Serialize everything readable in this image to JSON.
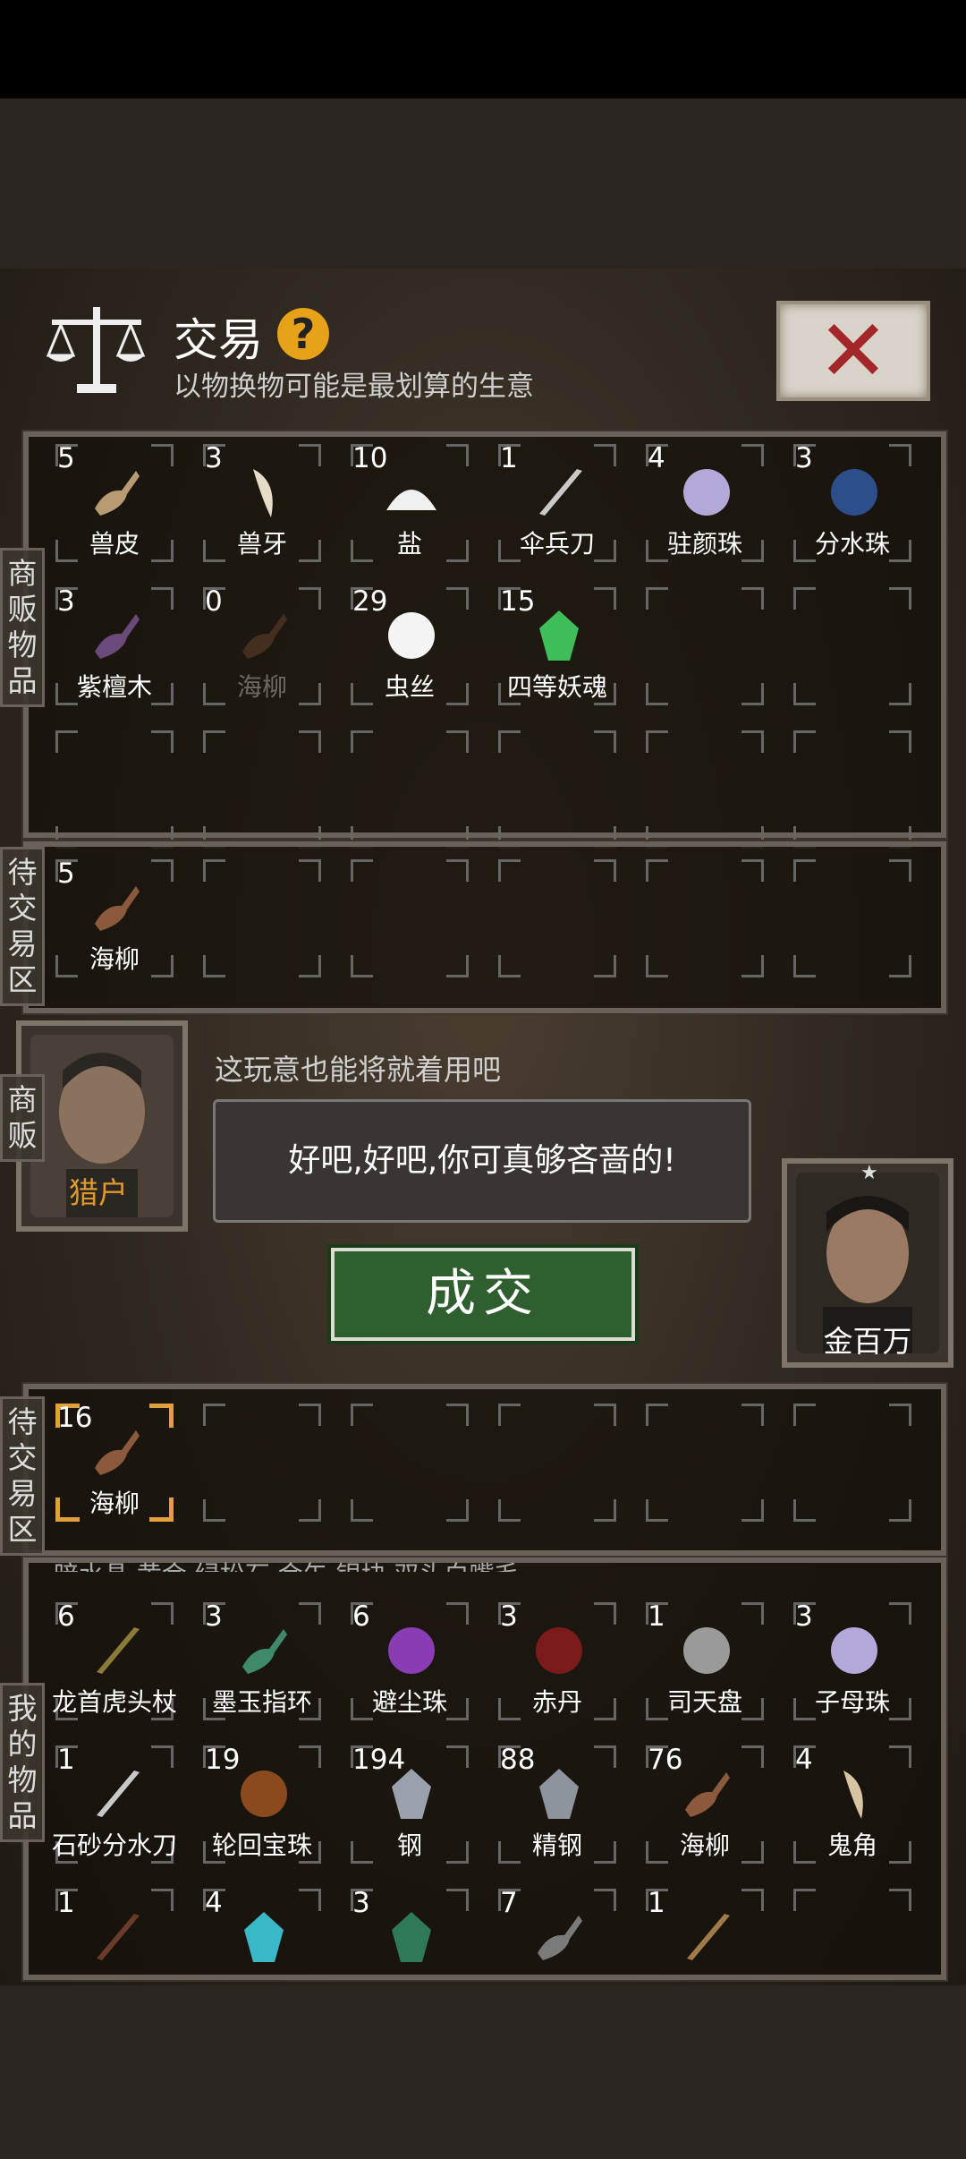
{
  "header": {
    "title": "交易",
    "help_icon": "?",
    "subtitle": "以物换物可能是最划算的生意",
    "close_icon": "close-x-icon"
  },
  "side_labels": {
    "merchant_goods": "商贩物品",
    "pending_top": "待交易区",
    "merchant": "商贩",
    "pending_bottom": "待交易区",
    "my_goods": "我的物品"
  },
  "merchant_items": [
    {
      "count": "5",
      "name": "兽皮",
      "icon": "hide-icon"
    },
    {
      "count": "3",
      "name": "兽牙",
      "icon": "fang-icon"
    },
    {
      "count": "10",
      "name": "盐",
      "icon": "salt-icon"
    },
    {
      "count": "1",
      "name": "伞兵刀",
      "icon": "knife-icon"
    },
    {
      "count": "4",
      "name": "驻颜珠",
      "icon": "pearl-icon"
    },
    {
      "count": "3",
      "name": "分水珠",
      "icon": "blue-orb-icon"
    },
    {
      "count": "3",
      "name": "紫檀木",
      "icon": "wood-icon"
    },
    {
      "count": "0",
      "name": "海柳",
      "icon": "driftwood-icon"
    },
    {
      "count": "29",
      "name": "虫丝",
      "icon": "silk-icon"
    },
    {
      "count": "15",
      "name": "四等妖魂",
      "icon": "green-crystal-icon"
    }
  ],
  "pending_merchant": [
    {
      "count": "5",
      "name": "海柳",
      "icon": "driftwood-icon"
    }
  ],
  "merchant_npc": {
    "name": "猎户",
    "line": "这玩意也能将就着用吧",
    "reply": "好吧,好吧,你可真够吝啬的!"
  },
  "player": {
    "name": "金百万"
  },
  "deal_button": "成交",
  "pending_player": [
    {
      "count": "16",
      "name": "海柳",
      "icon": "driftwood-icon"
    }
  ],
  "cut_row_text": "暗水晶     黄金     绿松石     金矢     银块     双头白嘴毛",
  "my_items": [
    {
      "count": "6",
      "name": "龙首虎头杖",
      "icon": "staff-icon"
    },
    {
      "count": "3",
      "name": "墨玉指环",
      "icon": "jade-ring-icon"
    },
    {
      "count": "6",
      "name": "避尘珠",
      "icon": "purple-orb-icon"
    },
    {
      "count": "3",
      "name": "赤丹",
      "icon": "red-pill-icon"
    },
    {
      "count": "1",
      "name": "司天盘",
      "icon": "compass-icon"
    },
    {
      "count": "3",
      "name": "子母珠",
      "icon": "pearl-icon"
    },
    {
      "count": "1",
      "name": "石砂分水刀",
      "icon": "knife-icon"
    },
    {
      "count": "19",
      "name": "轮回宝珠",
      "icon": "fire-orb-icon"
    },
    {
      "count": "194",
      "name": "钢",
      "icon": "steel-icon"
    },
    {
      "count": "88",
      "name": "精钢",
      "icon": "refined-steel-icon"
    },
    {
      "count": "76",
      "name": "海柳",
      "icon": "driftwood-icon"
    },
    {
      "count": "4",
      "name": "鬼角",
      "icon": "horn-icon"
    },
    {
      "count": "1",
      "name": "",
      "icon": "needles-icon"
    },
    {
      "count": "4",
      "name": "",
      "icon": "cyan-crystal-icon"
    },
    {
      "count": "3",
      "name": "",
      "icon": "green-stone-icon"
    },
    {
      "count": "7",
      "name": "",
      "icon": "pistol-icon"
    },
    {
      "count": "1",
      "name": "",
      "icon": "stick-icon"
    }
  ]
}
